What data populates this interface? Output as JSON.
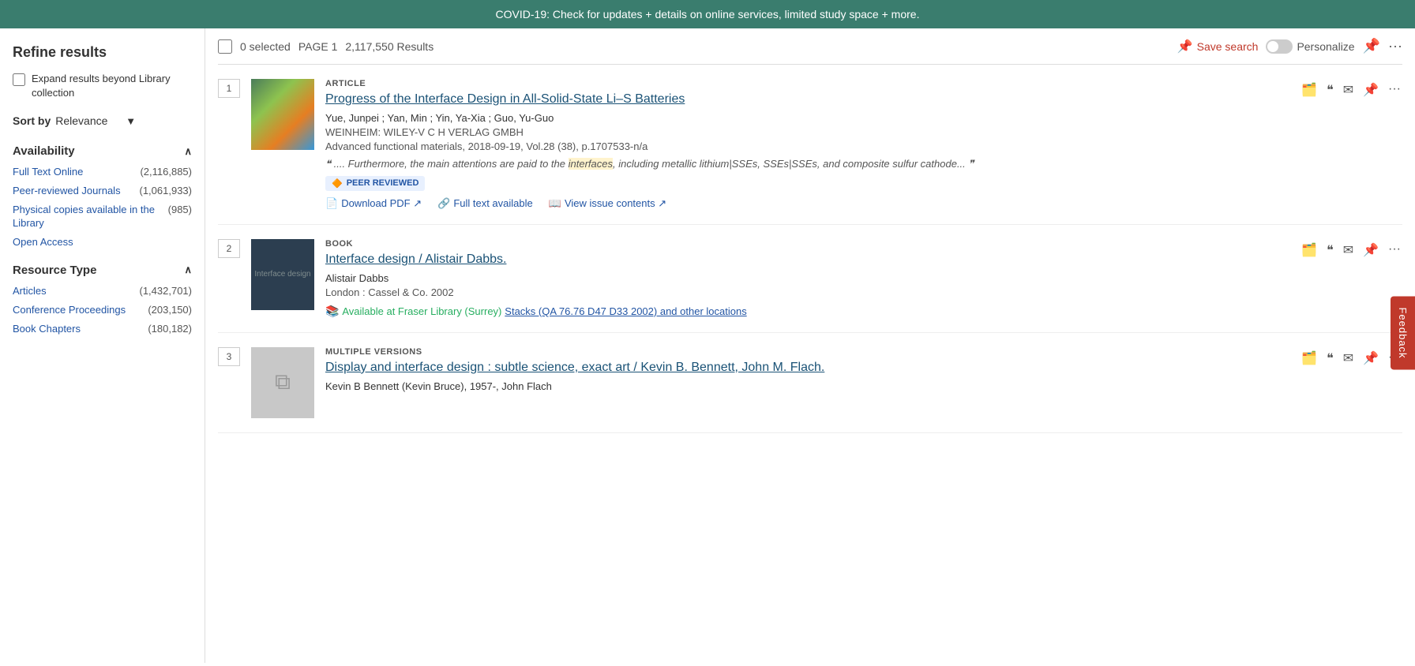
{
  "banner": {
    "text": "COVID-19: Check for updates + details on online services, limited study space + more."
  },
  "sidebar": {
    "title": "Refine results",
    "expand_label": "Expand results beyond Library collection",
    "sort": {
      "label": "Sort by",
      "value": "Relevance"
    },
    "availability": {
      "header": "Availability",
      "items": [
        {
          "label": "Full Text Online",
          "count": "(2,116,885)"
        },
        {
          "label": "Peer-reviewed Journals",
          "count": "(1,061,933)"
        },
        {
          "label": "Physical copies available in the Library",
          "count": "(985)"
        },
        {
          "label": "Open Access",
          "count": ""
        }
      ]
    },
    "resource_type": {
      "header": "Resource Type",
      "items": [
        {
          "label": "Articles",
          "count": "(1,432,701)"
        },
        {
          "label": "Conference Proceedings",
          "count": "(203,150)"
        },
        {
          "label": "Book Chapters",
          "count": "(180,182)"
        }
      ]
    }
  },
  "toolbar": {
    "selected_count": "0 selected",
    "page_label": "PAGE 1",
    "results_count": "2,117,550 Results",
    "save_search_label": "Save search",
    "personalize_label": "Personalize"
  },
  "results": [
    {
      "number": "1",
      "type": "ARTICLE",
      "title": "Progress of the Interface Design in All-Solid-State Li–S Batteries",
      "authors": "Yue, Junpei ; Yan, Min ; Yin, Ya-Xia ; Guo, Yu-Guo",
      "publisher": "WEINHEIM: WILEY-V C H VERLAG GMBH",
      "journal": "Advanced functional materials, 2018-09-19, Vol.28 (38), p.1707533-n/a",
      "snippet": ".... Furthermore, the main attentions are paid to the interfaces, including metallic lithium|SSEs, SSEs|SSEs, and composite sulfur cathode...",
      "highlight_word": "interfaces",
      "peer_reviewed": true,
      "peer_reviewed_label": "PEER REVIEWED",
      "links": [
        {
          "icon": "pdf",
          "label": "Download PDF",
          "external": true
        },
        {
          "icon": "link",
          "label": "Full text available",
          "external": false
        },
        {
          "icon": "book",
          "label": "View issue contents",
          "external": true
        }
      ],
      "has_thumb": true,
      "thumb_color": "#4a7c5a"
    },
    {
      "number": "2",
      "type": "BOOK",
      "title": "Interface design / Alistair Dabbs.",
      "authors": "Alistair Dabbs",
      "publisher": "London : Cassel & Co. 2002",
      "availability": "Available at Fraser Library (Surrey)",
      "location": "Stacks (QA 76.76 D47 D33 2002) and other locations",
      "peer_reviewed": false,
      "links": [],
      "has_thumb": true,
      "thumb_color": "#2c3e50"
    },
    {
      "number": "3",
      "type": "MULTIPLE VERSIONS",
      "title": "Display and interface design : subtle science, exact art / Kevin B. Bennett, John M. Flach.",
      "authors": "Kevin B Bennett (Kevin Bruce), 1957-, John Flach",
      "publisher": "",
      "peer_reviewed": false,
      "links": [],
      "has_thumb": false
    }
  ],
  "feedback_label": "Feedback"
}
